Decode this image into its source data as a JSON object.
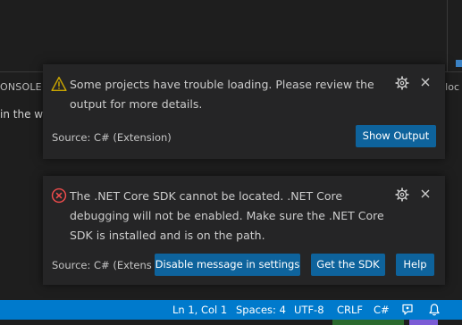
{
  "panel": {
    "tab_label": "ONSOLE",
    "right_label": "loc",
    "terminal_text": "in the w"
  },
  "toasts": [
    {
      "severity": "warning",
      "icon": "warning-icon",
      "message": "Some projects have trouble loading. Please review the output for more details.",
      "source": "Source: C# (Extension)",
      "actions": [
        "Show Output"
      ]
    },
    {
      "severity": "error",
      "icon": "error-icon",
      "message": "The .NET Core SDK cannot be located. .NET Core debugging will not be enabled. Make sure the .NET Core SDK is installed and is on the path.",
      "source": "Source: C# (Extensi...",
      "actions": [
        "Disable message in settings",
        "Get the SDK",
        "Help"
      ]
    }
  ],
  "statusbar": {
    "position": "Ln 1, Col 1",
    "spaces": "Spaces: 4",
    "encoding": "UTF-8",
    "eol": "CRLF",
    "language": "C#"
  },
  "colors": {
    "accent": "#007acc",
    "button": "#0e639c",
    "warning": "#cca700",
    "error": "#f14c4c",
    "toast_bg": "#252526"
  }
}
